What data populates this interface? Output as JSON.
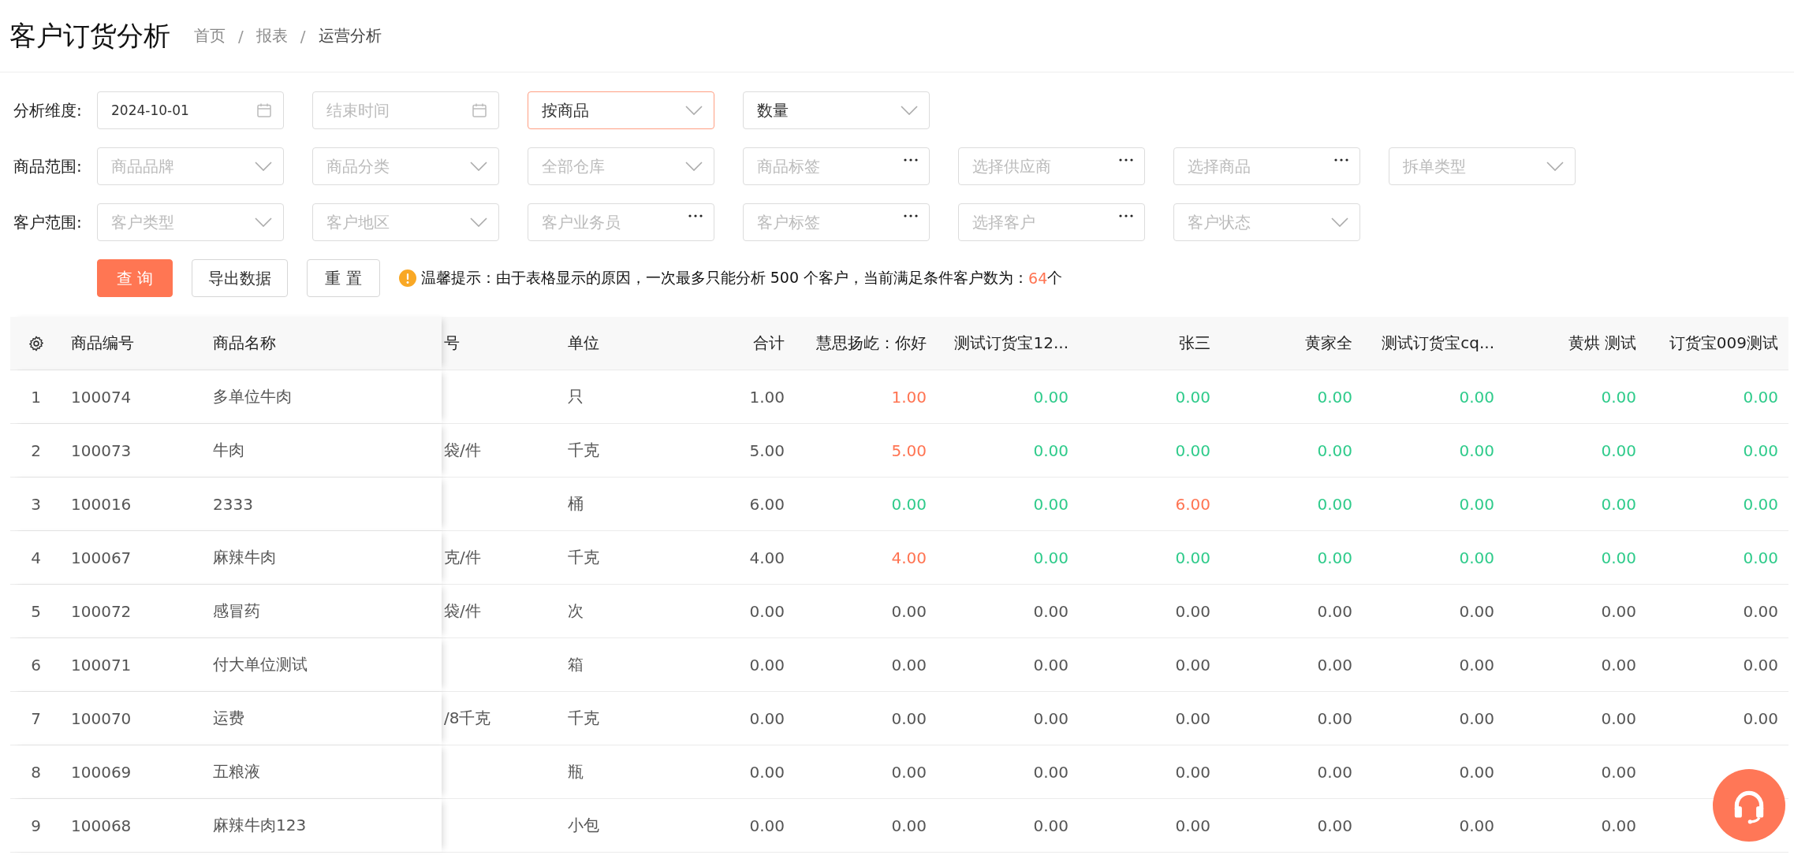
{
  "page": {
    "title": "客户订货分析",
    "breadcrumbs": [
      "首页",
      "报表",
      "运营分析"
    ],
    "breadcrumb_separator": "/"
  },
  "filter_rows": [
    {
      "label": "分析维度:",
      "fields": [
        {
          "kind": "date",
          "value": "2024-10-01",
          "focused": false
        },
        {
          "kind": "date",
          "placeholder": "结束时间",
          "focused": false
        },
        {
          "kind": "select",
          "value": "按商品",
          "focused": true
        },
        {
          "kind": "select",
          "value": "数量",
          "focused": false
        }
      ]
    },
    {
      "label": "商品范围:",
      "fields": [
        {
          "kind": "select",
          "placeholder": "商品品牌",
          "focused": false
        },
        {
          "kind": "select",
          "placeholder": "商品分类",
          "focused": false
        },
        {
          "kind": "select",
          "placeholder": "全部仓库",
          "focused": false
        },
        {
          "kind": "picker",
          "placeholder": "商品标签",
          "focused": false
        },
        {
          "kind": "picker",
          "placeholder": "选择供应商",
          "focused": false
        },
        {
          "kind": "picker",
          "placeholder": "选择商品",
          "focused": false
        },
        {
          "kind": "select",
          "placeholder": "拆单类型",
          "focused": false
        }
      ]
    },
    {
      "label": "客户范围:",
      "fields": [
        {
          "kind": "select",
          "placeholder": "客户类型",
          "focused": false
        },
        {
          "kind": "select",
          "placeholder": "客户地区",
          "focused": false
        },
        {
          "kind": "picker",
          "placeholder": "客户业务员",
          "focused": false
        },
        {
          "kind": "picker",
          "placeholder": "客户标签",
          "focused": false
        },
        {
          "kind": "picker",
          "placeholder": "选择客户",
          "focused": false
        },
        {
          "kind": "select",
          "placeholder": "客户状态",
          "focused": false
        }
      ]
    }
  ],
  "buttons": [
    {
      "label": "查 询",
      "kind": "primary"
    },
    {
      "label": "导出数据",
      "kind": "default"
    },
    {
      "label": "重 置",
      "kind": "default"
    }
  ],
  "notice": {
    "text": "温馨提示：由于表格显示的原因，一次最多只能分析 500 个客户，当前满足条件客户数为：",
    "count": "64",
    "unit": "个"
  },
  "table": {
    "columns": {
      "code": "商品编号",
      "name": "商品名称",
      "spec": "号",
      "unit": "单位",
      "total": "合计",
      "customers": [
        "慧思扬屹：你好",
        "测试订货宝12...",
        "张三",
        "黄家全",
        "测试订货宝cq...",
        "黄烘 测试",
        "订货宝009测试"
      ]
    },
    "rows": [
      {
        "index": "1",
        "code": "100074",
        "name": "多单位牛肉",
        "unit": "只",
        "total": "1.00",
        "values": [
          {
            "text": "1.00",
            "color": "#ff7452"
          },
          {
            "text": "0.00",
            "color": "#2fcb8b"
          },
          {
            "text": "0.00",
            "color": "#2fcb8b"
          },
          {
            "text": "0.00",
            "color": "#2fcb8b"
          },
          {
            "text": "0.00",
            "color": "#2fcb8b"
          },
          {
            "text": "0.00",
            "color": "#2fcb8b"
          },
          {
            "text": "0.00",
            "color": "#2fcb8b"
          }
        ]
      },
      {
        "index": "2",
        "code": "100073",
        "name": "牛肉",
        "spec": "袋/件",
        "unit": "千克",
        "total": "5.00",
        "values": [
          {
            "text": "5.00",
            "color": "#ff7452"
          },
          {
            "text": "0.00",
            "color": "#2fcb8b"
          },
          {
            "text": "0.00",
            "color": "#2fcb8b"
          },
          {
            "text": "0.00",
            "color": "#2fcb8b"
          },
          {
            "text": "0.00",
            "color": "#2fcb8b"
          },
          {
            "text": "0.00",
            "color": "#2fcb8b"
          },
          {
            "text": "0.00",
            "color": "#2fcb8b"
          }
        ]
      },
      {
        "index": "3",
        "code": "100016",
        "name": "2333",
        "unit": "桶",
        "total": "6.00",
        "values": [
          {
            "text": "0.00",
            "color": "#2fcb8b"
          },
          {
            "text": "0.00",
            "color": "#2fcb8b"
          },
          {
            "text": "6.00",
            "color": "#ff7452"
          },
          {
            "text": "0.00",
            "color": "#2fcb8b"
          },
          {
            "text": "0.00",
            "color": "#2fcb8b"
          },
          {
            "text": "0.00",
            "color": "#2fcb8b"
          },
          {
            "text": "0.00",
            "color": "#2fcb8b"
          }
        ]
      },
      {
        "index": "4",
        "code": "100067",
        "name": "麻辣牛肉",
        "spec": "克/件",
        "unit": "千克",
        "total": "4.00",
        "values": [
          {
            "text": "4.00",
            "color": "#ff7452"
          },
          {
            "text": "0.00",
            "color": "#2fcb8b"
          },
          {
            "text": "0.00",
            "color": "#2fcb8b"
          },
          {
            "text": "0.00",
            "color": "#2fcb8b"
          },
          {
            "text": "0.00",
            "color": "#2fcb8b"
          },
          {
            "text": "0.00",
            "color": "#2fcb8b"
          },
          {
            "text": "0.00",
            "color": "#2fcb8b"
          }
        ]
      },
      {
        "index": "5",
        "code": "100072",
        "name": "感冒药",
        "spec": "袋/件",
        "unit": "次",
        "total": "0.00",
        "values": [
          {
            "text": "0.00"
          },
          {
            "text": "0.00"
          },
          {
            "text": "0.00"
          },
          {
            "text": "0.00"
          },
          {
            "text": "0.00"
          },
          {
            "text": "0.00"
          },
          {
            "text": "0.00"
          }
        ]
      },
      {
        "index": "6",
        "code": "100071",
        "name": "付大单位测试",
        "unit": "箱",
        "total": "0.00",
        "values": [
          {
            "text": "0.00"
          },
          {
            "text": "0.00"
          },
          {
            "text": "0.00"
          },
          {
            "text": "0.00"
          },
          {
            "text": "0.00"
          },
          {
            "text": "0.00"
          },
          {
            "text": "0.00"
          }
        ]
      },
      {
        "index": "7",
        "code": "100070",
        "name": "运费",
        "spec": "/8千克",
        "unit": "千克",
        "total": "0.00",
        "values": [
          {
            "text": "0.00"
          },
          {
            "text": "0.00"
          },
          {
            "text": "0.00"
          },
          {
            "text": "0.00"
          },
          {
            "text": "0.00"
          },
          {
            "text": "0.00"
          },
          {
            "text": "0.00"
          }
        ]
      },
      {
        "index": "8",
        "code": "100069",
        "name": "五粮液",
        "unit": "瓶",
        "total": "0.00",
        "values": [
          {
            "text": "0.00"
          },
          {
            "text": "0.00"
          },
          {
            "text": "0.00"
          },
          {
            "text": "0.00"
          },
          {
            "text": "0.00"
          },
          {
            "text": "0.00"
          }
        ]
      },
      {
        "index": "9",
        "code": "100068",
        "name": "麻辣牛肉123",
        "unit": "小包",
        "total": "0.00",
        "values": [
          {
            "text": "0.00"
          },
          {
            "text": "0.00"
          },
          {
            "text": "0.00"
          },
          {
            "text": "0.00"
          },
          {
            "text": "0.00"
          },
          {
            "text": "0.00"
          }
        ]
      }
    ]
  }
}
